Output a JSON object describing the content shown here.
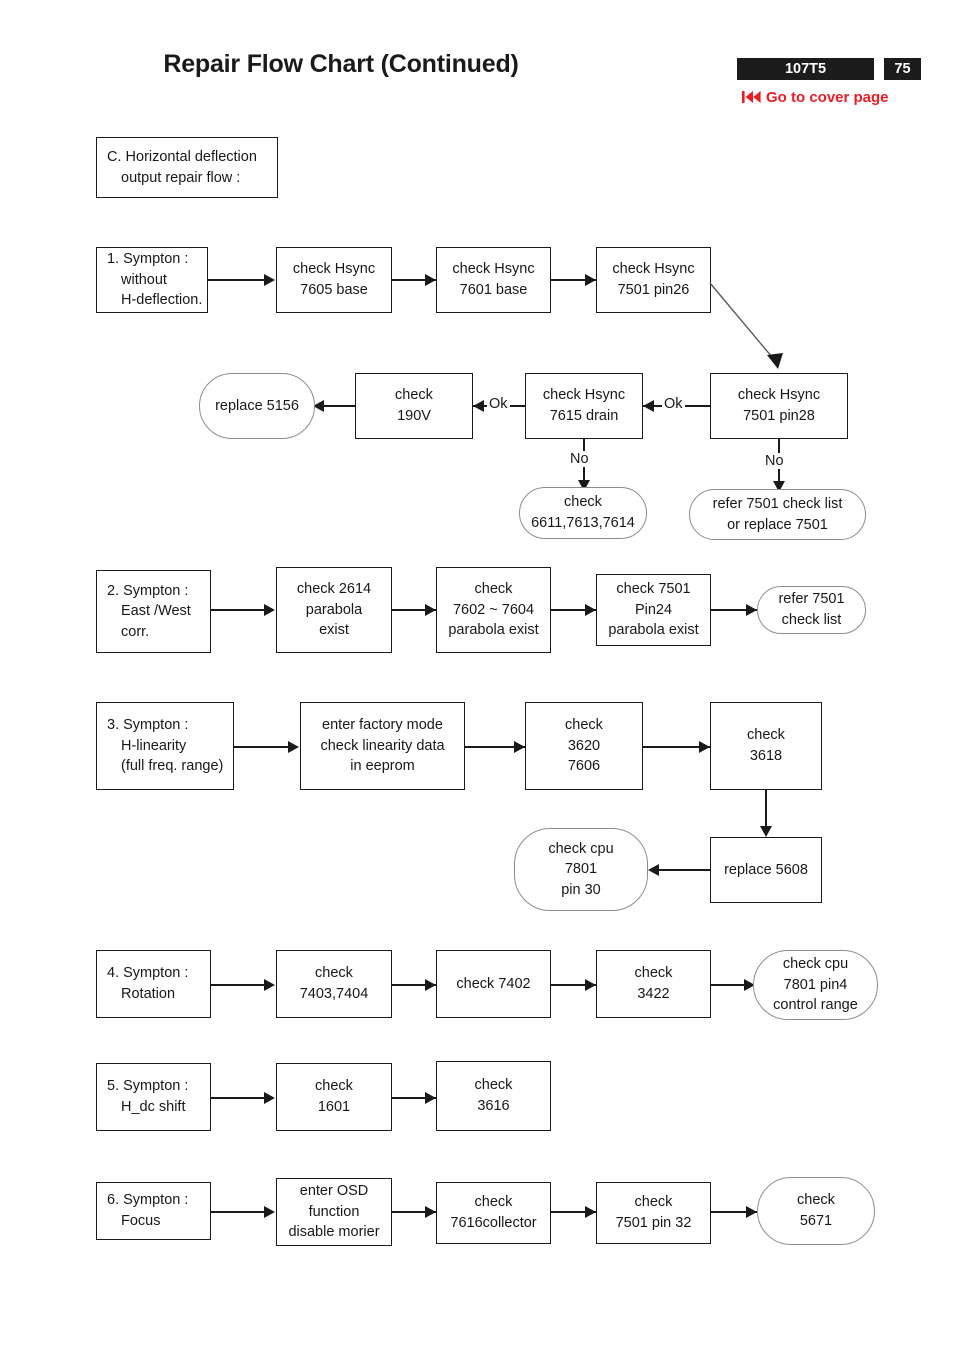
{
  "header": {
    "title": "Repair Flow Chart (Continued)",
    "model_badge": "107T5",
    "page_number": "75",
    "cover_link": "Go to cover page",
    "cover_link_icon": "rewind-to-start-icon",
    "accent_color": "#ec1c24",
    "badge_color": "#1c1c1c"
  },
  "section_header": {
    "line1": "C. Horizontal deflection",
    "line2": "output repair flow :"
  },
  "flows": [
    {
      "id": "flow-1",
      "symptom": {
        "line1": "1. Sympton :",
        "line2": "without",
        "line3": "H-deflection."
      },
      "steps": [
        {
          "id": "check-hsync-7605",
          "line1": "check Hsync",
          "line2": "7605 base"
        },
        {
          "id": "check-hsync-7601",
          "line1": "check Hsync",
          "line2": "7601 base"
        },
        {
          "id": "check-hsync-7501-pin26",
          "line1": "check Hsync",
          "line2": "7501 pin26"
        },
        {
          "id": "check-hsync-7501-pin28",
          "line1": "check Hsync",
          "line2": "7501 pin28"
        },
        {
          "id": "check-hsync-7615-drain",
          "line1": "check Hsync",
          "line2": "7615 drain"
        },
        {
          "id": "check-190v",
          "line1": "check",
          "line2": "190V"
        },
        {
          "id": "replace-5156",
          "line1": "replace 5156"
        },
        {
          "id": "check-6611",
          "line1": "check",
          "line2": "6611,7613,7614"
        },
        {
          "id": "refer-7501",
          "line1": "refer 7501  check list",
          "line2": "or replace 7501"
        }
      ],
      "edge_labels": {
        "ok_1": "Ok",
        "ok_2": "Ok",
        "no_1": "No",
        "no_2": "No"
      }
    },
    {
      "id": "flow-2",
      "symptom": {
        "line1": "2. Sympton :",
        "line2": "East /West",
        "line3": "corr."
      },
      "steps": [
        {
          "id": "check-2614",
          "line1": "check 2614",
          "line2": "parabola",
          "line3": "exist"
        },
        {
          "id": "check-7602-7604",
          "line1": "check",
          "line2": "7602 ~ 7604",
          "line3": "parabola exist"
        },
        {
          "id": "check-7501-pin24",
          "line1": "check 7501",
          "line2": "Pin24",
          "line3": "parabola exist"
        },
        {
          "id": "refer-7501-check-list",
          "line1": "refer 7501",
          "line2": "check list"
        }
      ]
    },
    {
      "id": "flow-3",
      "symptom": {
        "line1": "3. Sympton :",
        "line2": "H-linearity",
        "line3": "(full freq. range)"
      },
      "steps": [
        {
          "id": "enter-factory-mode",
          "line1": "enter factory mode",
          "line2": "check linearity data",
          "line3": "in eeprom"
        },
        {
          "id": "check-3620-7606",
          "line1": "check",
          "line2": "3620",
          "line3": "7606"
        },
        {
          "id": "check-3618",
          "line1": "check",
          "line2": "3618"
        },
        {
          "id": "replace-5608",
          "line1": "replace 5608"
        },
        {
          "id": "check-cpu-7801-pin30",
          "line1": "check cpu",
          "line2": "7801",
          "line3": "pin 30"
        }
      ]
    },
    {
      "id": "flow-4",
      "symptom": {
        "line1": "4. Sympton :",
        "line2": "Rotation"
      },
      "steps": [
        {
          "id": "check-7403-7404",
          "line1": "check",
          "line2": "7403,7404"
        },
        {
          "id": "check-7402",
          "line1": "check 7402"
        },
        {
          "id": "check-3422",
          "line1": "check",
          "line2": "3422"
        },
        {
          "id": "check-cpu-7801-pin4",
          "line1": "check cpu",
          "line2": "7801 pin4",
          "line3": "control range"
        }
      ]
    },
    {
      "id": "flow-5",
      "symptom": {
        "line1": "5. Sympton :",
        "line2": "H_dc shift"
      },
      "steps": [
        {
          "id": "check-1601",
          "line1": "check",
          "line2": "1601"
        },
        {
          "id": "check-3616",
          "line1": "check",
          "line2": "3616"
        }
      ]
    },
    {
      "id": "flow-6",
      "symptom": {
        "line1": "6. Sympton :",
        "line2": "Focus"
      },
      "steps": [
        {
          "id": "enter-osd",
          "line1": "enter OSD",
          "line2": "function",
          "line3": "disable morier"
        },
        {
          "id": "check-7616collector",
          "line1": "check",
          "line2": "7616collector"
        },
        {
          "id": "check-7501-pin32",
          "line1": "check",
          "line2": "7501 pin 32"
        },
        {
          "id": "check-5671",
          "line1": "check",
          "line2": "5671"
        }
      ]
    }
  ]
}
